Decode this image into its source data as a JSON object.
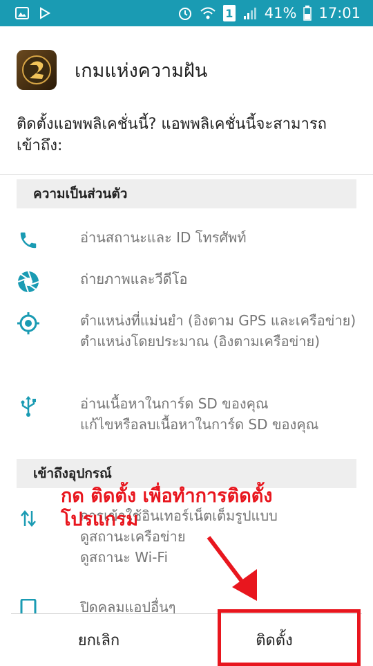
{
  "status_bar": {
    "battery_percent": "41%",
    "time": "17:01",
    "sim_label": "1"
  },
  "app": {
    "name": "เกมแห่งความฝัน"
  },
  "question": "ติดตั้งแอพพลิเคชั่นนี้? แอพพลิเคชั่นนี้จะสามารถเข้าถึง:",
  "sections": {
    "privacy": "ความเป็นส่วนตัว",
    "device": "เข้าถึงอุปกรณ์"
  },
  "permissions": {
    "phone": [
      "อ่านสถานะและ ID โทรศัพท์"
    ],
    "camera": [
      "ถ่ายภาพและวีดีโอ"
    ],
    "location": [
      "ตำแหน่งที่แม่นยำ (อิงตาม GPS และเครือข่าย)",
      "ตำแหน่งโดยประมาณ (อิงตามเครือข่าย)"
    ],
    "storage": [
      "อ่านเนื้อหาในการ์ด SD ของคุณ",
      "แก้ไขหรือลบเนื้อหาในการ์ด SD ของคุณ"
    ],
    "network": [
      "การเข้าใช้อินเทอร์เน็ตเต็มรูปแบบ",
      "ดูสถานะเครือข่าย",
      "ดูสถานะ Wi-Fi"
    ],
    "apps": [
      "ปิดคลมแอปอื่นๆ"
    ]
  },
  "buttons": {
    "cancel": "ยกเลิก",
    "install": "ติดตั้ง"
  },
  "annotation": {
    "text": "กด ติดตั้ง เพื่อทำการติดตั้งโปรแกรม",
    "color": "#e8161e"
  },
  "colors": {
    "status_bar": "#1a9bb3",
    "icon_accent": "#1a9bb3"
  }
}
